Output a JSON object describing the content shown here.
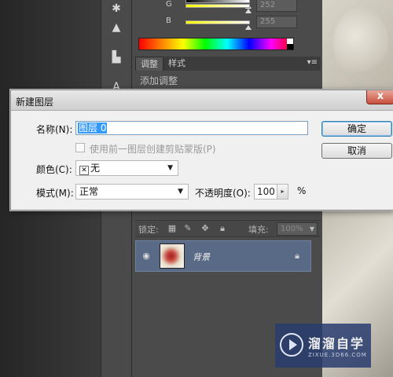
{
  "color_panel": {
    "rows": [
      {
        "letter": "",
        "value": "252"
      },
      {
        "letter": "G",
        "value": "252"
      },
      {
        "letter": "B",
        "value": "255"
      }
    ]
  },
  "adjustments": {
    "tabs": [
      "调整",
      "样式"
    ],
    "title": "添加调整"
  },
  "layers": {
    "lock_label": "锁定:",
    "fill_label": "填充:",
    "fill_value": "100%",
    "layer_name": "背景"
  },
  "dialog": {
    "title": "新建图层",
    "close_glyph": "x",
    "name_label": "名称(N):",
    "name_value": "图层 0",
    "clip_label": "使用前一图层创建剪贴蒙版(P)",
    "color_label": "颜色(C):",
    "color_value": "无",
    "mode_label": "模式(M):",
    "mode_value": "正常",
    "opacity_label": "不透明度(O):",
    "opacity_value": "100",
    "percent": "%",
    "ok_label": "确定",
    "cancel_label": "取消"
  },
  "watermark": {
    "text": "溜溜自学",
    "subtext": "ZIXUE.3D66.COM"
  },
  "colors": {
    "dialog_bg": "#f0f0f0",
    "panel_bg": "#4b4b4b",
    "layer_selected": "#586a86",
    "close_button": "#c8503c"
  }
}
